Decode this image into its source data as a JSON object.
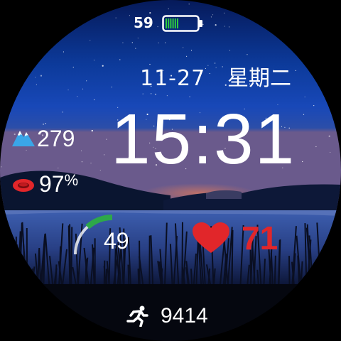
{
  "battery": {
    "percent": "59",
    "level": 0.59,
    "color": "#2ecc40"
  },
  "date": {
    "day": "11-27",
    "weekday": "星期二"
  },
  "time": "15:31",
  "altitude": {
    "value": "279",
    "icon": "mountain-icon",
    "color": "#3aa6e8"
  },
  "spo2": {
    "value": "97",
    "unit": "%",
    "icon": "blood-drop-icon",
    "color": "#e1262a"
  },
  "gauge": {
    "value": "49",
    "level": 0.5,
    "color": "#2ea84a"
  },
  "heart_rate": {
    "value": "71",
    "icon": "heart-icon",
    "color": "#e1262a"
  },
  "steps": {
    "value": "9414",
    "icon": "running-icon"
  }
}
